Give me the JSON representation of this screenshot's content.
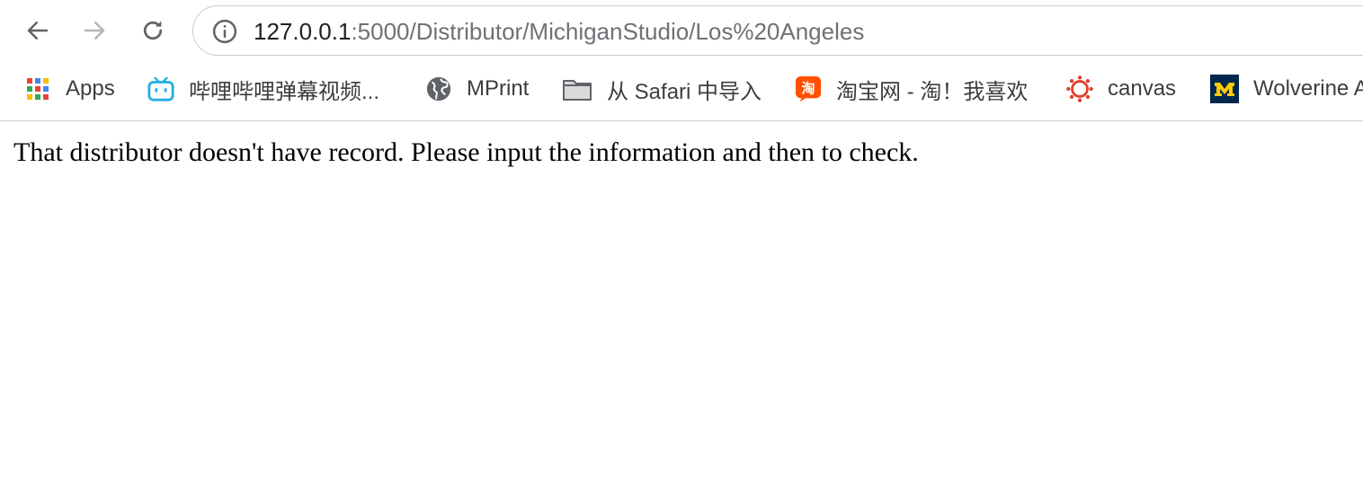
{
  "browser": {
    "url_host": "127.0.0.1",
    "url_rest": ":5000/Distributor/MichiganStudio/Los%20Angeles",
    "colors": {
      "url_host": "#202124",
      "url_rest": "#6e7175",
      "bilibili": "#23ade5",
      "taobao": "#ff5000",
      "canvas": "#e13f2b",
      "michigan_blue": "#00274c",
      "michigan_maize": "#ffcb05"
    }
  },
  "bookmarks": [
    {
      "label": "Apps",
      "icon": "apps-grid-icon"
    },
    {
      "label": "哔哩哔哩弹幕视频...",
      "icon": "bilibili-tv-icon"
    },
    {
      "label": "MPrint",
      "icon": "globe-icon"
    },
    {
      "label": "从 Safari 中导入",
      "icon": "folder-icon"
    },
    {
      "label": "淘宝网 - 淘！我喜欢",
      "icon": "taobao-icon"
    },
    {
      "label": "canvas",
      "icon": "canvas-icon"
    },
    {
      "label": "Wolverine A",
      "icon": "michigan-block-m-icon"
    }
  ],
  "page": {
    "message": "That distributor doesn't have record. Please input the information and then to check."
  }
}
